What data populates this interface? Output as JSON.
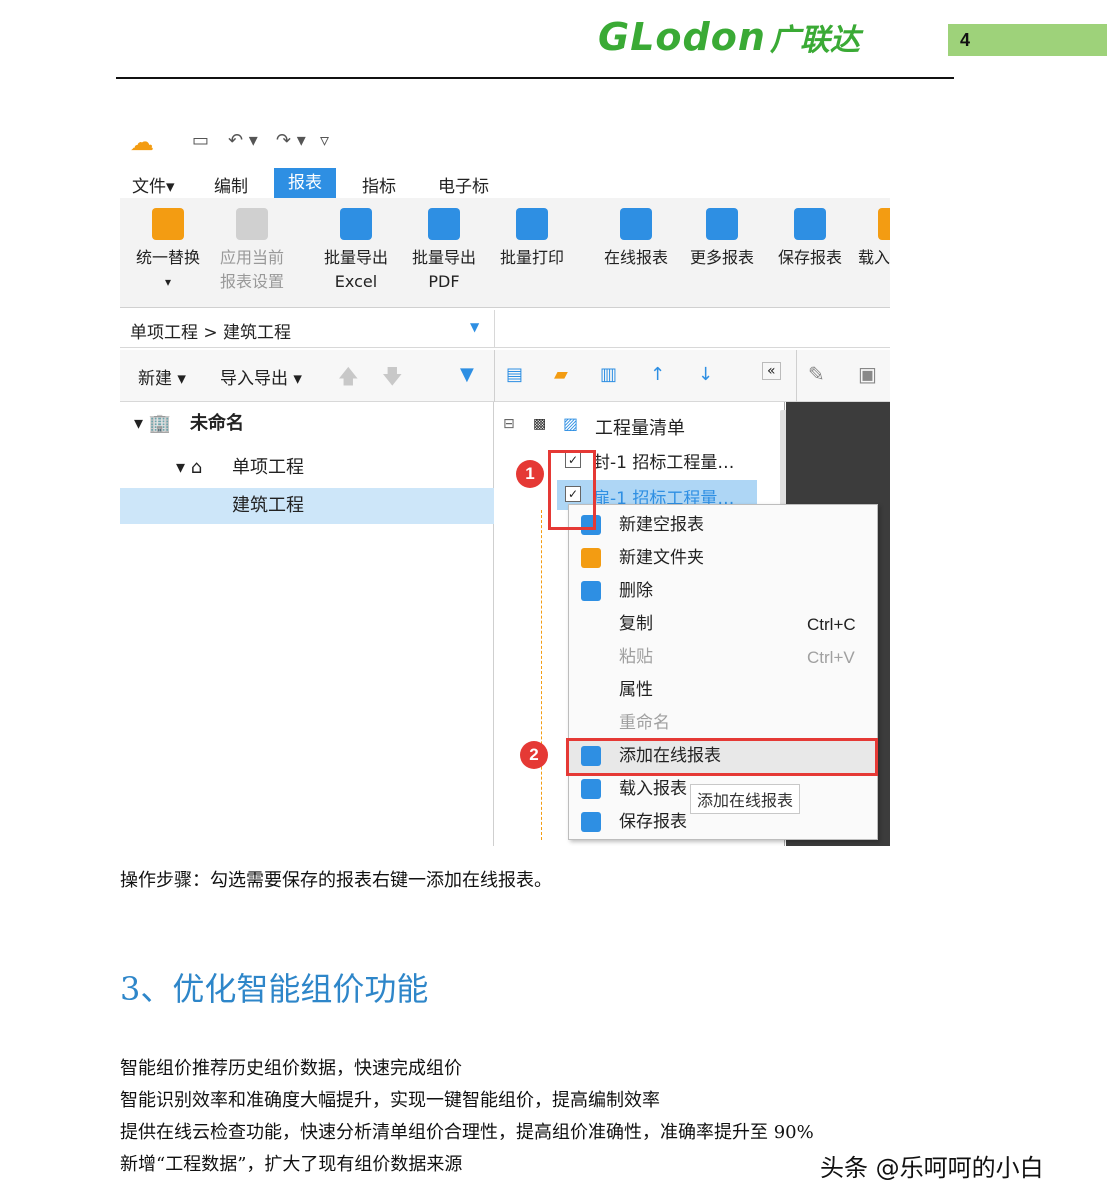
{
  "doc_header": {
    "logo_en": "GLodon",
    "logo_cn": "广联达",
    "page_number": "4",
    "accent_color": "#9ed27a"
  },
  "app": {
    "quick_access": {
      "logo_icon": "glodon-cloud-icon",
      "save_icon": "save-icon",
      "undo": "↶ ▾",
      "redo": "↷ ▾",
      "customize": "▿"
    },
    "menus": [
      {
        "label": "文件▾",
        "active": false
      },
      {
        "label": "编制",
        "active": false
      },
      {
        "label": "报表",
        "active": true
      },
      {
        "label": "指标",
        "active": false
      },
      {
        "label": "电子标",
        "active": false
      }
    ],
    "ribbon": [
      {
        "line1": "统一替换",
        "line2": "▾",
        "icon_color": "#f39c12",
        "disabled": false
      },
      {
        "line1": "应用当前",
        "line2": "报表设置",
        "icon_color": "#bdbdbd",
        "disabled": true
      },
      {
        "line1": "批量导出",
        "line2": "Excel",
        "icon_color": "#2e8fe3",
        "disabled": false
      },
      {
        "line1": "批量导出",
        "line2": "PDF",
        "icon_color": "#2e8fe3",
        "disabled": false
      },
      {
        "line1": "批量打印",
        "line2": "",
        "icon_color": "#2e8fe3",
        "disabled": false
      },
      {
        "line1": "在线报表",
        "line2": "",
        "icon_color": "#2e8fe3",
        "disabled": false
      },
      {
        "line1": "更多报表",
        "line2": "",
        "icon_color": "#2e8fe3",
        "disabled": false
      },
      {
        "line1": "保存报表",
        "line2": "",
        "icon_color": "#2e8fe3",
        "disabled": false
      },
      {
        "line1": "载入",
        "line2": "",
        "icon_color": "#f39c12",
        "disabled": false
      }
    ],
    "breadcrumb": "单项工程 > 建筑工程",
    "left_toolbar": {
      "new": "新建 ▾",
      "import_export": "导入导出 ▾",
      "pin": "📌"
    },
    "tree": [
      {
        "label": "未命名",
        "prefix": "▾ 🏢"
      },
      {
        "label": "单项工程",
        "prefix": "▾ ⌂"
      },
      {
        "label": "建筑工程",
        "prefix": ""
      }
    ],
    "report_tree": {
      "root": "工程量清单",
      "items": [
        {
          "label": "封-1 招标工程量…"
        },
        {
          "label": "扉-1 招标工程量…"
        }
      ]
    },
    "context_menu": [
      {
        "label": "新建空报表",
        "key": "",
        "disabled": false,
        "icon_color": "#2e8fe3"
      },
      {
        "label": "新建文件夹",
        "key": "",
        "disabled": false,
        "icon_color": "#f39c12"
      },
      {
        "label": "删除",
        "key": "",
        "disabled": false,
        "icon_color": "#2e8fe3"
      },
      {
        "label": "复制",
        "key": "Ctrl+C",
        "disabled": false,
        "icon_color": ""
      },
      {
        "label": "粘贴",
        "key": "Ctrl+V",
        "disabled": true,
        "icon_color": ""
      },
      {
        "label": "属性",
        "key": "",
        "disabled": false,
        "icon_color": ""
      },
      {
        "label": "重命名",
        "key": "",
        "disabled": true,
        "icon_color": ""
      },
      {
        "label": "添加在线报表",
        "key": "",
        "disabled": false,
        "icon_color": "#2e8fe3"
      },
      {
        "label": "载入报表",
        "key": "",
        "disabled": false,
        "icon_color": "#2e8fe3"
      },
      {
        "label": "保存报表",
        "key": "",
        "disabled": false,
        "icon_color": "#2e8fe3"
      }
    ],
    "tooltip": "添加在线报表",
    "badges": [
      "1",
      "2"
    ]
  },
  "caption": "操作步骤：勾选需要保存的报表右键一添加在线报表。",
  "section_heading": "3、优化智能组价功能",
  "paragraphs": [
    "智能组价推荐历史组价数据，快速完成组价",
    "智能识别效率和准确度大幅提升，实现一键智能组价，提高编制效率",
    "提供在线云检查功能，快速分析清单组价合理性，提高组价准确性，准确率提升至 90%",
    "新增“工程数据”，扩大了现有组价数据来源"
  ],
  "watermark": "头条 @乐呵呵的小白"
}
